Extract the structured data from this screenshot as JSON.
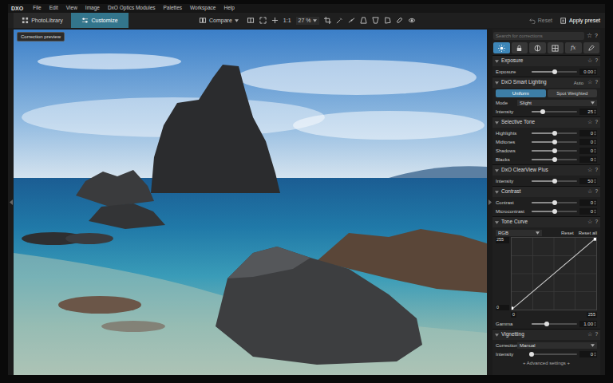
{
  "menu": {
    "logo": "DXO",
    "items": [
      "File",
      "Edit",
      "View",
      "Image",
      "DxO Optics Modules",
      "Palettes",
      "Workspace",
      "Help"
    ]
  },
  "toolbar": {
    "tabs": [
      {
        "label": "PhotoLibrary",
        "selected": false
      },
      {
        "label": "Customize",
        "selected": true
      }
    ],
    "compare": "Compare",
    "zoom_fit": "1:1",
    "zoom": "27 %",
    "reset": "Reset",
    "apply_preset": "Apply preset"
  },
  "viewer": {
    "correction_preview": "Correction preview"
  },
  "panel": {
    "search_placeholder": "Search for corrections",
    "star": "☆",
    "help": "?",
    "tabs": [
      {
        "kind": "light",
        "selected": true
      },
      {
        "kind": "color",
        "selected": false
      },
      {
        "kind": "detail",
        "selected": false
      },
      {
        "kind": "geometry",
        "selected": false
      },
      {
        "kind": "effects",
        "label": "fx",
        "selected": false
      },
      {
        "kind": "local",
        "selected": false
      }
    ],
    "palettes": [
      {
        "title": "Exposure",
        "rows": [
          {
            "kind": "slider",
            "label": "Exposure",
            "value": "0.00",
            "level": 0.5
          }
        ]
      },
      {
        "title": "DxO Smart Lighting",
        "badge": "Auto",
        "rows": [
          {
            "kind": "toggle",
            "options": [
              {
                "label": "Uniform",
                "selected": true
              },
              {
                "label": "Spot Weighted",
                "selected": false
              }
            ]
          },
          {
            "kind": "select",
            "label": "Mode",
            "value": "Slight"
          },
          {
            "kind": "slider",
            "label": "Intensity",
            "value": "25",
            "level": 0.25
          }
        ]
      },
      {
        "title": "Selective Tone",
        "rows": [
          {
            "kind": "slider",
            "label": "Highlights",
            "value": "0",
            "level": 0.5
          },
          {
            "kind": "slider",
            "label": "Midtones",
            "value": "0",
            "level": 0.5
          },
          {
            "kind": "slider",
            "label": "Shadows",
            "value": "0",
            "level": 0.5
          },
          {
            "kind": "slider",
            "label": "Blacks",
            "value": "0",
            "level": 0.5
          }
        ]
      },
      {
        "title": "DxO ClearView Plus",
        "rows": [
          {
            "kind": "slider",
            "label": "Intensity",
            "value": "50",
            "level": 0.5
          }
        ]
      },
      {
        "title": "Contrast",
        "rows": [
          {
            "kind": "slider",
            "label": "Contrast",
            "value": "0",
            "level": 0.5
          },
          {
            "kind": "slider",
            "label": "Microcontrast",
            "value": "0",
            "level": 0.5
          }
        ]
      },
      {
        "title": "Tone Curve",
        "rows": [
          {
            "kind": "curve",
            "channel": "RGB",
            "reset": "Reset",
            "reset_all": "Reset all",
            "top": "255",
            "left": "0",
            "bottom_left": "0",
            "bottom_right": "255"
          },
          {
            "kind": "slider",
            "label": "Gamma",
            "value": "1.00",
            "level": 0.33
          }
        ]
      },
      {
        "title": "Vignetting",
        "rows": [
          {
            "kind": "select",
            "label": "Correction",
            "value": "Manual"
          },
          {
            "kind": "slider",
            "label": "Intensity",
            "value": "0",
            "level": 0
          },
          {
            "kind": "link",
            "label": "+ Advanced settings +"
          }
        ]
      }
    ]
  }
}
